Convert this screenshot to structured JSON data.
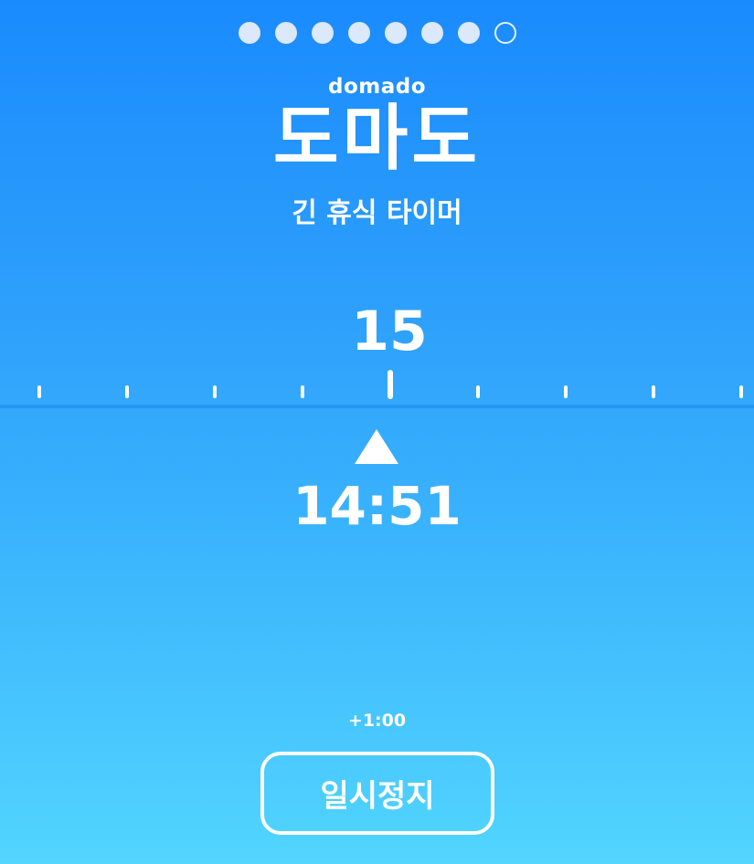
{
  "progress": {
    "total_steps": 8,
    "current_step": 8
  },
  "header": {
    "brand_en": "domado",
    "brand_ko": "도마도",
    "subtitle": "긴 휴식 타이머"
  },
  "timer": {
    "minute_marker": "15",
    "remaining": "14:51"
  },
  "controls": {
    "add_time_label": "+1:00",
    "pause_label": "일시정지"
  },
  "colors": {
    "gradient_top": "#1a8bfd",
    "gradient_bottom": "#52d5fe",
    "text": "#ffffff"
  }
}
